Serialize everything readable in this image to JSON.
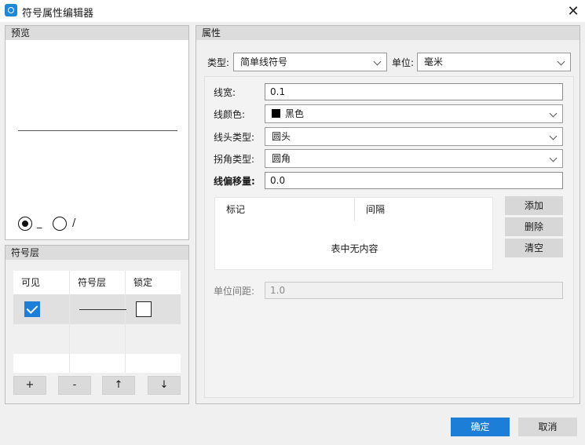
{
  "window": {
    "title": "符号属性编辑器"
  },
  "preview": {
    "title": "预览",
    "options": [
      {
        "label": "_",
        "checked": true
      },
      {
        "label": "/",
        "checked": false
      }
    ]
  },
  "layers": {
    "title": "符号层",
    "columns": [
      "可见",
      "符号层",
      "锁定"
    ],
    "rows": [
      {
        "visible": true,
        "locked": false
      }
    ],
    "buttons": [
      "+",
      "-",
      "↑",
      "↓"
    ]
  },
  "properties": {
    "title": "属性",
    "type_label": "类型:",
    "type_value": "简单线符号",
    "unit_label": "单位:",
    "unit_value": "毫米",
    "width_label": "线宽:",
    "width_value": "0.1",
    "color_label": "线颜色:",
    "color_value": "黑色",
    "color_hex": "#000000",
    "cap_label": "线头类型:",
    "cap_value": "圆头",
    "join_label": "拐角类型:",
    "join_value": "圆角",
    "offset_label": "线偏移量:",
    "offset_value": "0.0",
    "mark_columns": [
      "标记",
      "间隔"
    ],
    "mark_empty": "表中无内容",
    "add_label": "添加",
    "delete_label": "删除",
    "clear_label": "清空",
    "unit_spacing_label": "单位间距:",
    "unit_spacing_value": "1.0"
  },
  "footer": {
    "ok_label": "确定",
    "cancel_label": "取消"
  }
}
